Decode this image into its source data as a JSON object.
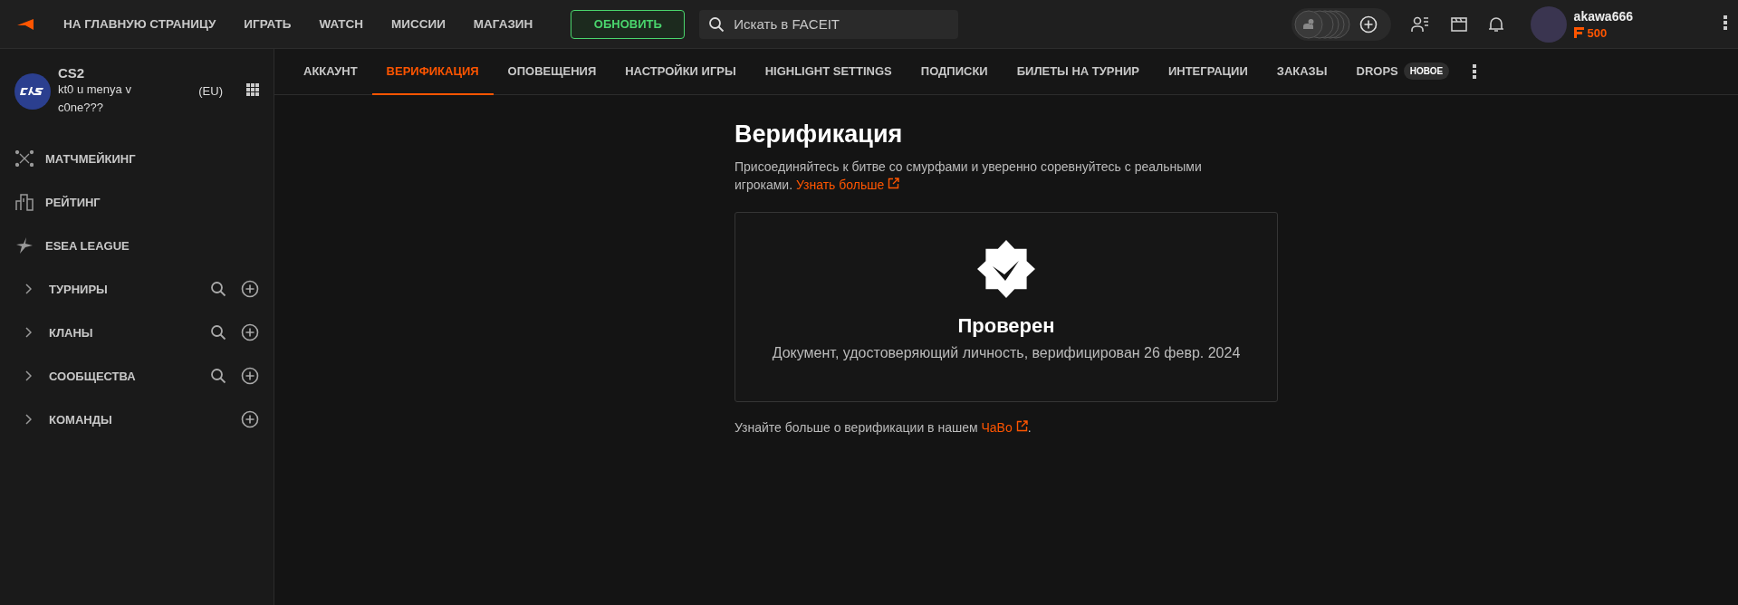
{
  "top_nav": {
    "links": [
      "НА ГЛАВНУЮ СТРАНИЦУ",
      "ИГРАТЬ",
      "WATCH",
      "МИССИИ",
      "МАГАЗИН"
    ],
    "update_button": "ОБНОВИТЬ",
    "search": {
      "placeholder": "Искать в FACEIT"
    },
    "user": {
      "name": "akawa666",
      "points": "500"
    }
  },
  "sidebar": {
    "game": {
      "title": "CS2",
      "team": "kt0 u menya v c0ne???",
      "region": "(EU)"
    },
    "items": [
      {
        "label": "МАТЧМЕЙКИНГ",
        "kind": "matchmaking"
      },
      {
        "label": "РЕЙТИНГ",
        "kind": "ranking"
      },
      {
        "label": "ESEA LEAGUE",
        "kind": "league"
      },
      {
        "label": "ТУРНИРЫ",
        "kind": "section",
        "search": true,
        "add": true
      },
      {
        "label": "КЛАНЫ",
        "kind": "section",
        "search": true,
        "add": true
      },
      {
        "label": "СООБЩЕСТВА",
        "kind": "section",
        "search": true,
        "add": true
      },
      {
        "label": "КОМАНДЫ",
        "kind": "section",
        "search": false,
        "add": true
      }
    ]
  },
  "tabs": [
    {
      "label": "АККАУНТ",
      "selected": false
    },
    {
      "label": "ВЕРИФИКАЦИЯ",
      "selected": true
    },
    {
      "label": "ОПОВЕЩЕНИЯ",
      "selected": false
    },
    {
      "label": "НАСТРОЙКИ ИГРЫ",
      "selected": false
    },
    {
      "label": "HIGHLIGHT SETTINGS",
      "selected": false
    },
    {
      "label": "ПОДПИСКИ",
      "selected": false
    },
    {
      "label": "БИЛЕТЫ НА ТУРНИР",
      "selected": false
    },
    {
      "label": "ИНТЕГРАЦИИ",
      "selected": false
    },
    {
      "label": "ЗАКАЗЫ",
      "selected": false
    },
    {
      "label": "DROPS",
      "selected": false,
      "badge": "НОВОЕ"
    }
  ],
  "verification": {
    "title": "Верификация",
    "description": "Присоединяйтесь к битве со смурфами и уверенно соревнуйтесь с реальными игроками.",
    "learn_more_link": "Узнать больше",
    "status": "Проверен",
    "detail": "Документ, удостоверяющий личность, верифицирован 26 февр. 2024",
    "footer_text": "Узнайте больше о верификации в нашем",
    "footer_link": "ЧаВо",
    "footer_end": "."
  }
}
